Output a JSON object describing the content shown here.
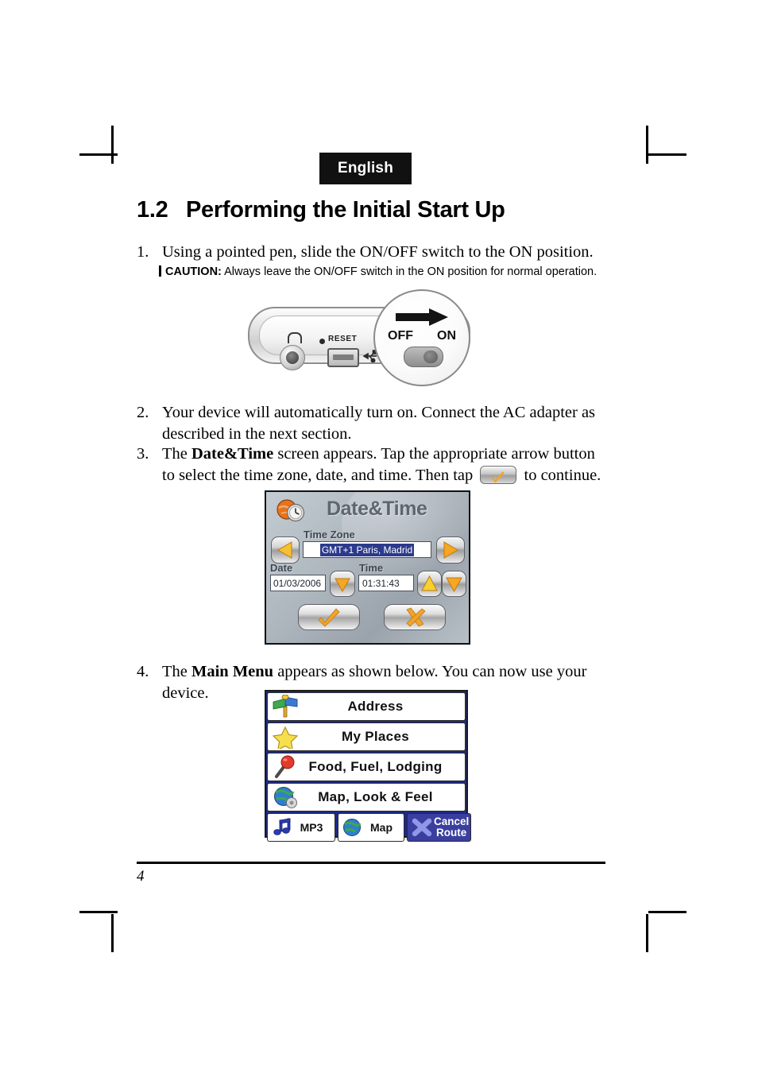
{
  "page": {
    "language_banner": "English",
    "page_number": "4"
  },
  "heading": {
    "number": "1.2",
    "title": "Performing the Initial Start Up"
  },
  "steps": [
    {
      "marker": "1.",
      "text": "Using a pointed pen, slide the ON/OFF switch to the ON position."
    },
    {
      "marker": "2.",
      "text": "Your device will automatically turn on. Connect the AC adapter as described in the next section."
    },
    {
      "marker": "3.",
      "text_part1": "The ",
      "bold1": "Date&Time",
      "text_part2": " screen appears. Tap the appropriate arrow button to select the time zone, date, and time. Then tap ",
      "text_part3": " to continue."
    },
    {
      "marker": "4.",
      "text_part1": "The ",
      "bold1": "Main Menu",
      "text_part2": " appears as shown below. You can now use your device."
    }
  ],
  "caution": {
    "keyword": "CAUTION:",
    "text": " Always leave the ON/OFF switch in the ON position for normal operation."
  },
  "device_figure": {
    "reset_label": "RESET",
    "headphone_icon": "headphone-jack-icon",
    "usb_icon": "usb-icon",
    "switch_off_label": "OFF",
    "switch_on_label": "ON",
    "arrow_icon": "right-arrow-icon"
  },
  "datetime_screen": {
    "title": "Date&Time",
    "title_icon": "globe-clock-icon",
    "timezone_label": "Time Zone",
    "timezone_value": "GMT+1 Paris, Madrid",
    "date_label": "Date",
    "date_value": "01/03/2006",
    "time_label": "Time",
    "time_value": "01:31:43",
    "buttons": {
      "tz_prev": "left-arrow-button",
      "tz_next": "right-arrow-button",
      "date_down": "down-arrow-button",
      "time_up": "up-arrow-button",
      "time_down": "down-arrow-button",
      "ok": "checkmark-button",
      "cancel": "x-button"
    },
    "colors": {
      "selection": "#2b3a8c",
      "background": "#aeb6be",
      "accent": "#f5a623"
    }
  },
  "main_menu": {
    "items": [
      {
        "label": "Address",
        "icon": "signpost-icon"
      },
      {
        "label": "My Places",
        "icon": "star-icon"
      },
      {
        "label": "Food, Fuel, Lodging",
        "icon": "map-pin-icon"
      },
      {
        "label": "Map, Look & Feel",
        "icon": "globe-gear-icon"
      }
    ],
    "bottom_buttons": [
      {
        "label": "MP3",
        "icon": "music-note-icon"
      },
      {
        "label": "Map",
        "icon": "globe-icon"
      }
    ],
    "cancel_button": {
      "line1": "Cancel",
      "line2": "Route",
      "icon": "x-icon"
    },
    "colors": {
      "frame": "#1b2a8a",
      "cancel_bg": "#3a3f9e"
    }
  }
}
